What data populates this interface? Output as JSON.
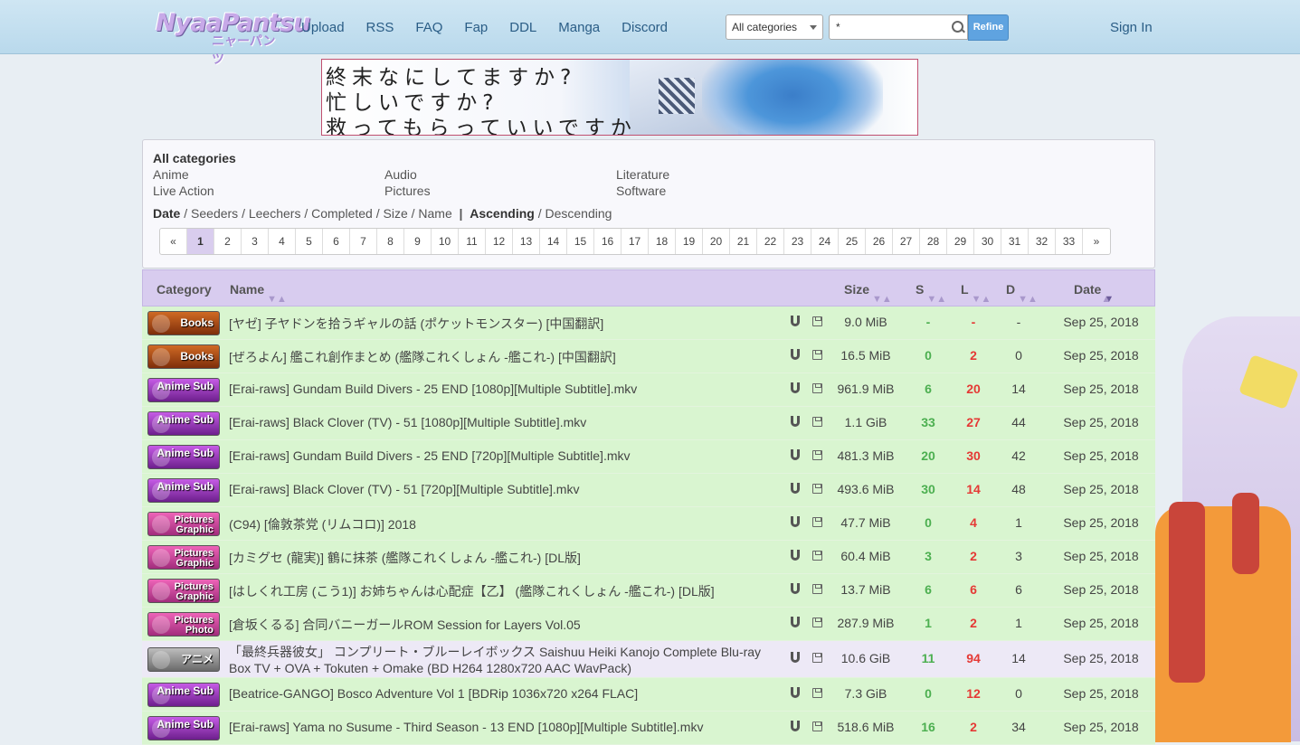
{
  "header": {
    "logo_text": "NyaaPantsu",
    "logo_subtext": "ニャーパンツ",
    "nav": [
      "Upload",
      "RSS",
      "FAQ",
      "Fap",
      "DDL",
      "Manga",
      "Discord"
    ],
    "category_select": "All categories",
    "search_value": "*",
    "refine_label": "Refine",
    "signin_label": "Sign In"
  },
  "banner": {
    "lines": [
      "終末なにしてますか?",
      "忙しいですか?",
      "救ってもらっていいですか"
    ]
  },
  "filters": {
    "all_categories": "All categories",
    "categories": [
      "Anime",
      "Audio",
      "Literature",
      "Live Action",
      "Pictures",
      "Software"
    ],
    "sort_label": "Date",
    "sort_options": [
      "Seeders",
      "Leechers",
      "Completed",
      "Size",
      "Name"
    ],
    "order_active": "Ascending",
    "order_other": "Descending",
    "pages": [
      "«",
      "1",
      "2",
      "3",
      "4",
      "5",
      "6",
      "7",
      "8",
      "9",
      "10",
      "11",
      "12",
      "13",
      "14",
      "15",
      "16",
      "17",
      "18",
      "19",
      "20",
      "21",
      "22",
      "23",
      "24",
      "25",
      "26",
      "27",
      "28",
      "29",
      "30",
      "31",
      "32",
      "33",
      "»"
    ],
    "current_page": "1"
  },
  "table": {
    "headers": {
      "category": "Category",
      "name": "Name",
      "size": "Size",
      "seeders": "S",
      "leechers": "L",
      "downloads": "D",
      "date": "Date"
    },
    "rows": [
      {
        "badge": "Books",
        "badge_type": "books",
        "name": "[ヤゼ] 子ヤドンを拾うギャルの話 (ポケットモンスター) [中国翻訳]",
        "size": "9.0 MiB",
        "s": "-",
        "l": "-",
        "d": "-",
        "date": "Sep 25, 2018"
      },
      {
        "badge": "Books",
        "badge_type": "books",
        "name": "[ぜろよん] 艦これ創作まとめ (艦隊これくしょん -艦これ-) [中国翻訳]",
        "size": "16.5 MiB",
        "s": "0",
        "l": "2",
        "d": "0",
        "date": "Sep 25, 2018"
      },
      {
        "badge": "Anime Sub",
        "badge_type": "anime",
        "name": "[Erai-raws] Gundam Build Divers - 25 END [1080p][Multiple Subtitle].mkv",
        "size": "961.9 MiB",
        "s": "6",
        "l": "20",
        "d": "14",
        "date": "Sep 25, 2018"
      },
      {
        "badge": "Anime Sub",
        "badge_type": "anime",
        "name": "[Erai-raws] Black Clover (TV) - 51 [1080p][Multiple Subtitle].mkv",
        "size": "1.1 GiB",
        "s": "33",
        "l": "27",
        "d": "44",
        "date": "Sep 25, 2018"
      },
      {
        "badge": "Anime Sub",
        "badge_type": "anime",
        "name": "[Erai-raws] Gundam Build Divers - 25 END [720p][Multiple Subtitle].mkv",
        "size": "481.3 MiB",
        "s": "20",
        "l": "30",
        "d": "42",
        "date": "Sep 25, 2018"
      },
      {
        "badge": "Anime Sub",
        "badge_type": "anime",
        "name": "[Erai-raws] Black Clover (TV) - 51 [720p][Multiple Subtitle].mkv",
        "size": "493.6 MiB",
        "s": "30",
        "l": "14",
        "d": "48",
        "date": "Sep 25, 2018"
      },
      {
        "badge": "Pictures Graphic",
        "badge_type": "pics",
        "name": "(C94) [倫敦茶党 (リムコロ)] 2018",
        "size": "47.7 MiB",
        "s": "0",
        "l": "4",
        "d": "1",
        "date": "Sep 25, 2018"
      },
      {
        "badge": "Pictures Graphic",
        "badge_type": "pics",
        "name": "[カミグセ (龍実)] 鶴に抹茶 (艦隊これくしょん -艦これ-) [DL版]",
        "size": "60.4 MiB",
        "s": "3",
        "l": "2",
        "d": "3",
        "date": "Sep 25, 2018"
      },
      {
        "badge": "Pictures Graphic",
        "badge_type": "pics",
        "name": "[はしくれ工房 (こう1)] お姉ちゃんは心配症【乙】 (艦隊これくしょん -艦これ-) [DL版]",
        "size": "13.7 MiB",
        "s": "6",
        "l": "6",
        "d": "6",
        "date": "Sep 25, 2018"
      },
      {
        "badge": "Pictures Photo",
        "badge_type": "pics",
        "name": "[倉坂くるる] 合同バニーガールROM Session for Layers Vol.05",
        "size": "287.9 MiB",
        "s": "1",
        "l": "2",
        "d": "1",
        "date": "Sep 25, 2018"
      },
      {
        "badge": "アニメ",
        "badge_type": "raw",
        "name": "「最終兵器彼女」 コンプリート・ブルーレイボックス Saishuu Heiki Kanojo Complete Blu-ray Box TV + OVA + Tokuten + Omake (BD H264 1280x720 AAC WavPack)",
        "size": "10.6 GiB",
        "s": "11",
        "l": "94",
        "d": "14",
        "date": "Sep 25, 2018"
      },
      {
        "badge": "Anime Sub",
        "badge_type": "anime",
        "name": "[Beatrice-GANGO] Bosco Adventure Vol 1 [BDRip 1036x720 x264 FLAC]",
        "size": "7.3 GiB",
        "s": "0",
        "l": "12",
        "d": "0",
        "date": "Sep 25, 2018"
      },
      {
        "badge": "Anime Sub",
        "badge_type": "anime",
        "name": "[Erai-raws] Yama no Susume - Third Season - 13 END [1080p][Multiple Subtitle].mkv",
        "size": "518.6 MiB",
        "s": "16",
        "l": "2",
        "d": "34",
        "date": "Sep 25, 2018"
      }
    ]
  }
}
